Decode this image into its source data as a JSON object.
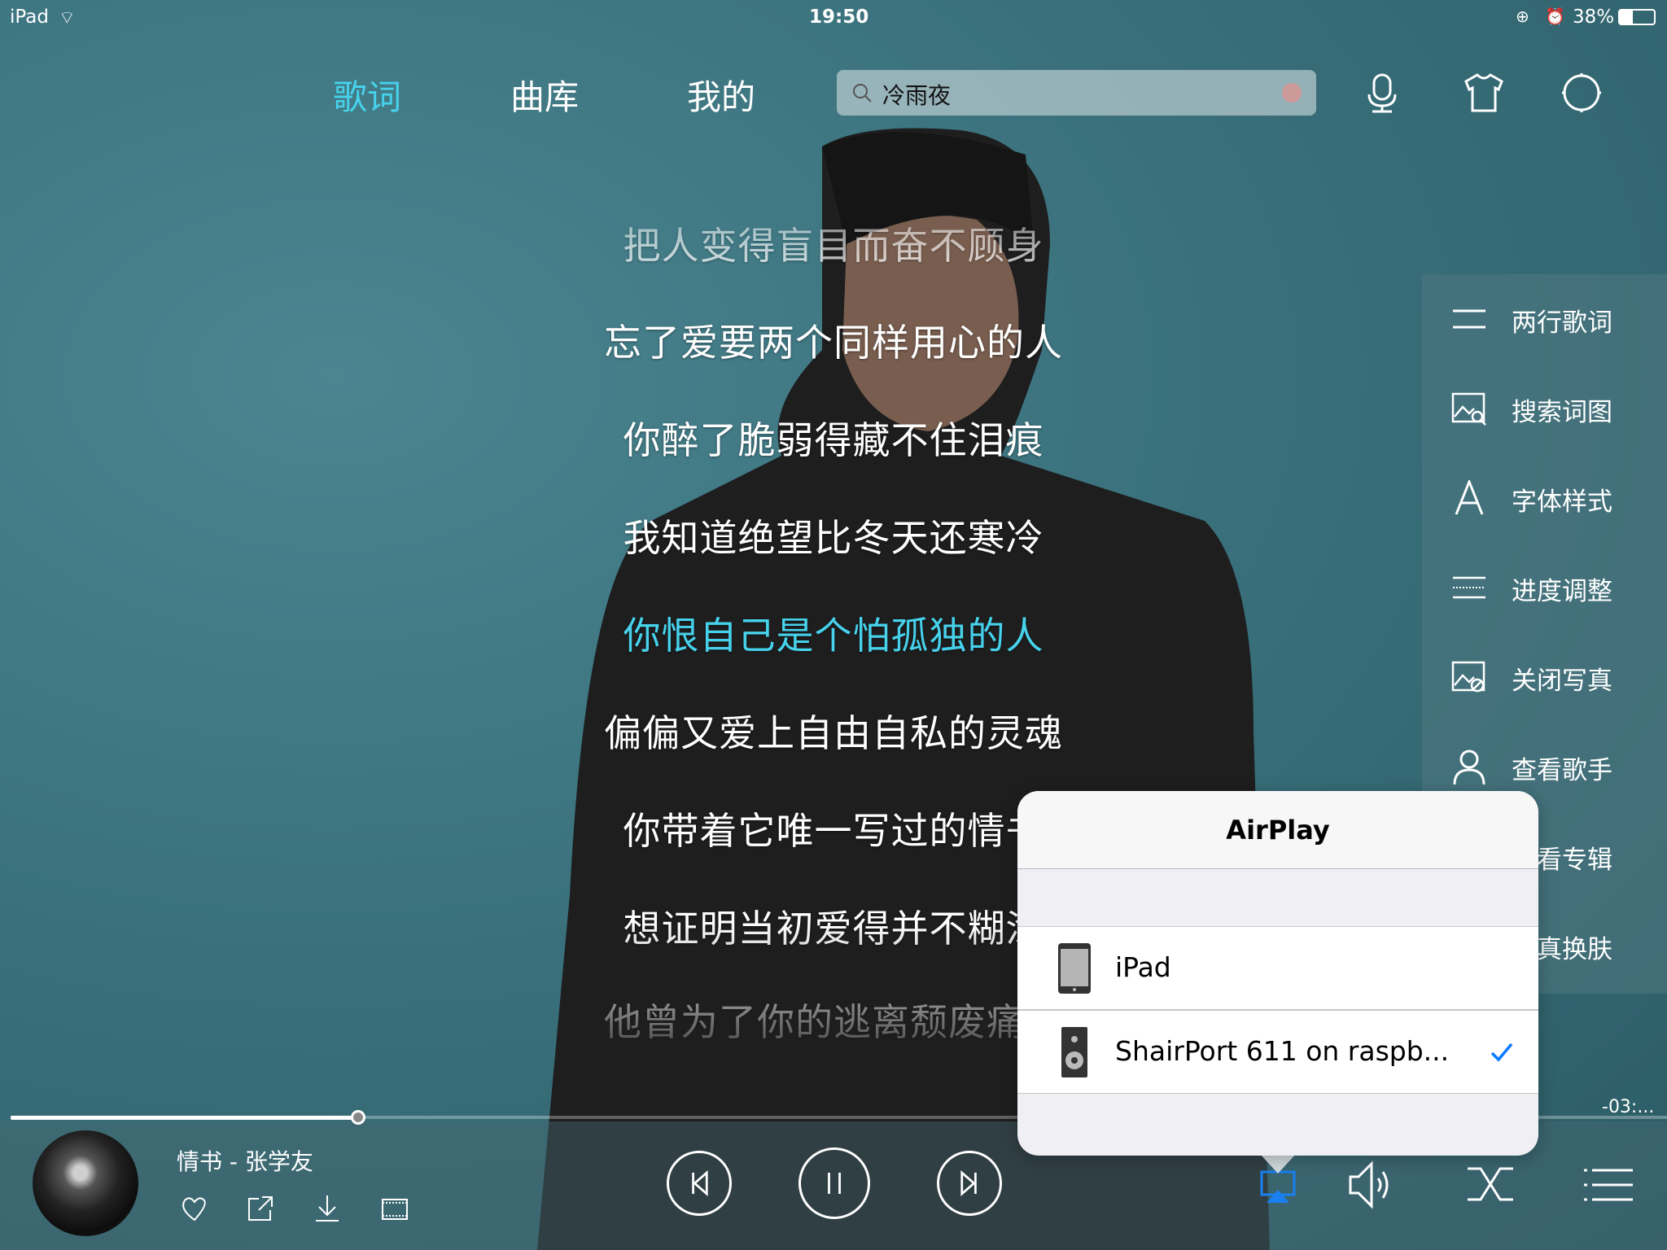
{
  "status_bar": {
    "device": "iPad",
    "time": "19:50",
    "battery": "38%",
    "battery_level": 0.38
  },
  "nav": {
    "tabs": [
      {
        "label": "歌词",
        "active": true
      },
      {
        "label": "曲库",
        "active": false
      },
      {
        "label": "我的",
        "active": false
      }
    ],
    "search": {
      "value": "冷雨夜"
    },
    "icons": [
      "microphone-icon",
      "shirt-icon",
      "settings-icon"
    ]
  },
  "colors": {
    "accent": "#47d2ec",
    "airplay_blue": "#1a7ff0",
    "check": "#0a7aff"
  },
  "lyrics": {
    "lines": [
      "把人变得盲目而奋不顾身",
      "忘了爱要两个同样用心的人",
      "你醉了脆弱得藏不住泪痕",
      "我知道绝望比冬天还寒冷",
      "你恨自己是个怕孤独的人",
      "偏偏又爱上自由自私的灵魂",
      "你带着它唯一写过的情书",
      "想证明当初爱得并不糊涂",
      "他曾为了你的逃离颓废痛苦"
    ],
    "active_index": 4
  },
  "side_menu": {
    "items": [
      {
        "label": "两行歌词",
        "icon": "two-lines-icon"
      },
      {
        "label": "搜索词图",
        "icon": "image-search-icon"
      },
      {
        "label": "字体样式",
        "icon": "font-icon"
      },
      {
        "label": "进度调整",
        "icon": "progress-adjust-icon"
      },
      {
        "label": "关闭写真",
        "icon": "image-close-icon"
      },
      {
        "label": "查看歌手",
        "icon": "person-icon"
      },
      {
        "label": "查看专辑",
        "icon": "album-icon"
      },
      {
        "label": "写真换肤",
        "icon": "skin-icon"
      }
    ]
  },
  "airplay": {
    "title": "AirPlay",
    "devices": [
      {
        "label": "iPad",
        "icon": "ipad-icon",
        "selected": false
      },
      {
        "label": "ShairPort 611 on raspb...",
        "icon": "speaker-icon",
        "selected": true
      }
    ]
  },
  "player": {
    "song": "情书 - 张学友",
    "remaining": "-03:...",
    "progress": 0.21,
    "actions": [
      "heart-icon",
      "share-icon",
      "download-icon",
      "mv-icon"
    ],
    "controls": {
      "prev": "previous-icon",
      "play_pause": "pause-icon",
      "next": "next-icon"
    },
    "right_controls": [
      "airplay-icon",
      "volume-icon",
      "shuffle-icon",
      "playlist-icon"
    ]
  }
}
